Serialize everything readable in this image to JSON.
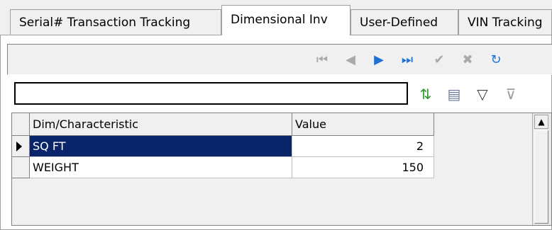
{
  "tabs": [
    {
      "label": "Serial# Transaction Tracking"
    },
    {
      "label": "Dimensional Inv",
      "active": true
    },
    {
      "label": "User-Defined"
    },
    {
      "label": "VIN Tracking"
    }
  ],
  "navigator": {
    "first": "first-record-icon",
    "prior": "prior-record-icon",
    "next": "next-record-icon",
    "last": "last-record-icon",
    "post": "post-icon",
    "cancel": "cancel-icon",
    "refresh": "refresh-icon"
  },
  "search": {
    "value": ""
  },
  "tools": [
    "sort-icon",
    "grid-columns-icon",
    "filter-icon",
    "clear-filter-icon"
  ],
  "grid": {
    "columns": [
      "Dim/Characteristic",
      "Value"
    ],
    "rows": [
      {
        "name": "SQ FT",
        "value": "2"
      },
      {
        "name": "WEIGHT",
        "value": "150"
      }
    ]
  },
  "colors": {
    "selection": "#0a246a",
    "accent": "#1e72d6"
  }
}
